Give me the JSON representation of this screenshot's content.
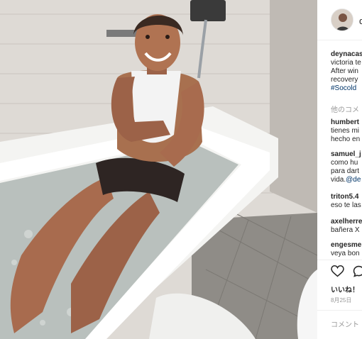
{
  "post": {
    "username": "deynacas",
    "caption_lines": [
      "victoria te",
      "After win",
      "recovery"
    ],
    "hashtag": "#Socold",
    "more_comments_label": "他のコメ",
    "comments": [
      {
        "user": "humbert",
        "lines": [
          "tienes mi",
          "hecho en"
        ]
      },
      {
        "user": "samuel_j",
        "lines": [
          "como hu",
          "para dart"
        ],
        "tail_text": "vida.",
        "mention": "@de"
      },
      {
        "user": "triton5.4",
        "lines": [
          "eso te las"
        ]
      },
      {
        "user": "axelherre",
        "lines": [
          "bañera X"
        ]
      },
      {
        "user": "engesme",
        "lines": [
          "veya bon"
        ]
      }
    ],
    "likes_label": "いいね！",
    "date": "8月25日",
    "comment_placeholder": "コメント"
  },
  "icons": {
    "like": "heart-icon",
    "comment": "comment-icon",
    "avatar": "avatar"
  },
  "colors": {
    "text": "#262626",
    "muted": "#999999",
    "link": "#003569",
    "divider": "#efefef"
  }
}
